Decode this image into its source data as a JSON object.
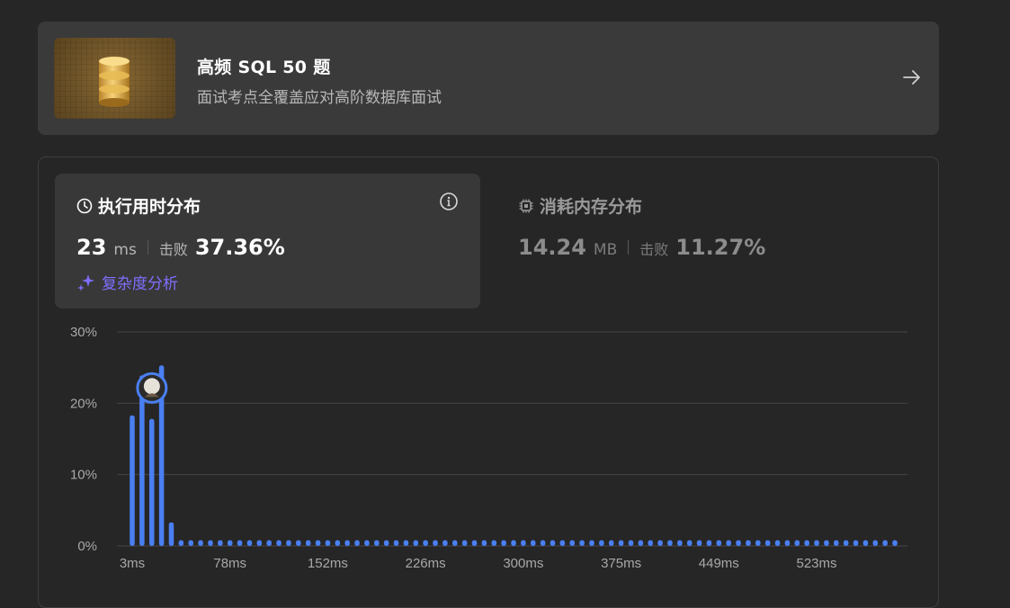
{
  "study_plan": {
    "title": "高频 SQL 50 题",
    "subtitle": "面试考点全覆盖应对高阶数据库面试",
    "thumb_icon": "database-icon",
    "arrow_icon": "arrow-right-icon"
  },
  "runtime": {
    "title": "执行用时分布",
    "icon": "clock-icon",
    "value": "23",
    "unit": "ms",
    "beats_label": "击败",
    "percent": "37.36%",
    "complexity_label": "复杂度分析",
    "complexity_icon": "sparkle-icon",
    "info_icon": "info-icon"
  },
  "memory": {
    "title": "消耗内存分布",
    "icon": "chip-icon",
    "value": "14.24",
    "unit": "MB",
    "beats_label": "击败",
    "percent": "11.27%"
  },
  "colors": {
    "bar": "#4a7ff2",
    "accent": "#7f6fff",
    "grid": "#454545"
  },
  "chart_data": {
    "type": "bar",
    "title": "",
    "xlabel": "",
    "ylabel": "",
    "ylim": [
      0,
      30
    ],
    "yticks": [
      "0%",
      "10%",
      "20%",
      "30%"
    ],
    "xticks": [
      "3ms",
      "78ms",
      "152ms",
      "226ms",
      "300ms",
      "375ms",
      "449ms",
      "523ms"
    ],
    "bar_count": 79,
    "values": [
      18.3,
      23.9,
      17.8,
      25.3,
      3.3,
      0.8,
      0.8,
      0.8,
      0.8,
      0.8,
      0.8,
      0.8,
      0.8,
      0.8,
      0.8,
      0.8,
      0.8,
      0.8,
      0.8,
      0.8,
      0.8,
      0.8,
      0.8,
      0.8,
      0.8,
      0.8,
      0.8,
      0.8,
      0.8,
      0.8,
      0.8,
      0.8,
      0.8,
      0.8,
      0.8,
      0.8,
      0.8,
      0.8,
      0.8,
      0.8,
      0.8,
      0.8,
      0.8,
      0.8,
      0.8,
      0.8,
      0.8,
      0.8,
      0.8,
      0.8,
      0.8,
      0.8,
      0.8,
      0.8,
      0.8,
      0.8,
      0.8,
      0.8,
      0.8,
      0.8,
      0.8,
      0.8,
      0.8,
      0.8,
      0.8,
      0.8,
      0.8,
      0.8,
      0.8,
      0.8,
      0.8,
      0.8,
      0.8,
      0.8,
      0.8,
      0.8,
      0.8,
      0.8,
      0.8
    ],
    "marker_index": 1,
    "marker_icon": "user-avatar-icon",
    "grid": true
  }
}
